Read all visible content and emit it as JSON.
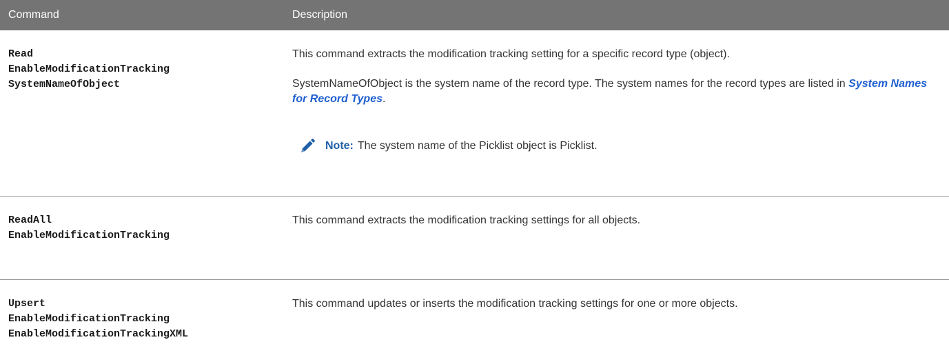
{
  "table": {
    "headers": {
      "command": "Command",
      "description": "Description"
    },
    "rows": [
      {
        "command_lines": [
          "Read",
          "EnableModificationTracking",
          "SystemNameOfObject"
        ],
        "description": "This command extracts the modification tracking setting for a specific record type (object).",
        "detail_before": "SystemNameOfObject is the system name of the record type. The system names for the record types are listed in ",
        "detail_link": "System Names for Record Types",
        "detail_after": ".",
        "note_label": "Note:",
        "note_text": "The system name of the Picklist object is Picklist."
      },
      {
        "command_lines": [
          "ReadAll",
          "EnableModificationTracking"
        ],
        "description": "This command extracts the modification tracking settings for all objects."
      },
      {
        "command_lines": [
          "Upsert",
          "EnableModificationTracking",
          "EnableModificationTrackingXML"
        ],
        "description": "This command updates or inserts the modification tracking settings for one or more objects."
      }
    ]
  },
  "colors": {
    "header_bg": "#747474",
    "link": "#1f5fd0",
    "note_accent": "#1f5fa8"
  },
  "icons": {
    "note": "pencil-icon"
  }
}
